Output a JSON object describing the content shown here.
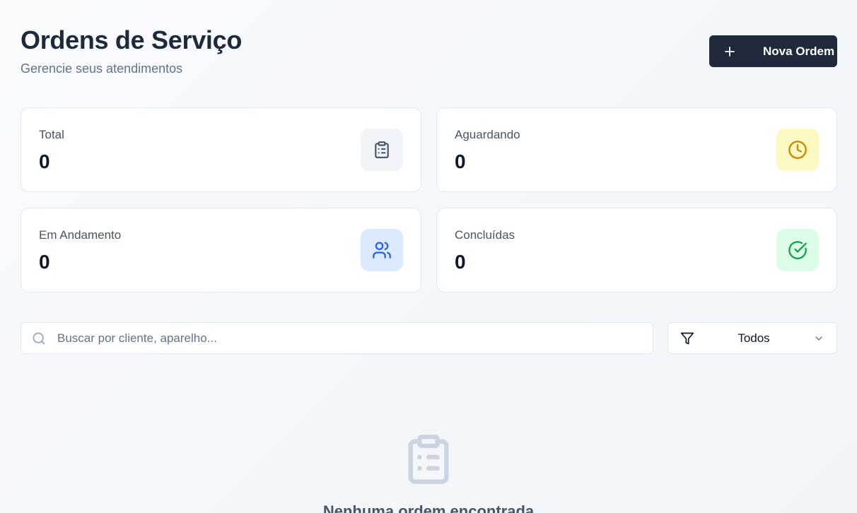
{
  "header": {
    "title": "Ordens de Serviço",
    "subtitle": "Gerencie seus atendimentos",
    "new_button_label": "Nova Ordem"
  },
  "stats": [
    {
      "label": "Total",
      "value": "0",
      "icon": "clipboard-list-icon"
    },
    {
      "label": "Aguardando",
      "value": "0",
      "icon": "clock-icon"
    },
    {
      "label": "Em Andamento",
      "value": "0",
      "icon": "users-icon"
    },
    {
      "label": "Concluídas",
      "value": "0",
      "icon": "check-circle-icon"
    }
  ],
  "search": {
    "placeholder": "Buscar por cliente, aparelho...",
    "value": ""
  },
  "filter": {
    "selected": "Todos"
  },
  "empty_state": {
    "title": "Nenhuma ordem encontrada",
    "icon": "clipboard-list-icon"
  },
  "colors": {
    "primary": "#1e293b",
    "yellow_accent": "#ca8a04",
    "blue_accent": "#2563eb",
    "green_accent": "#16a34a"
  }
}
